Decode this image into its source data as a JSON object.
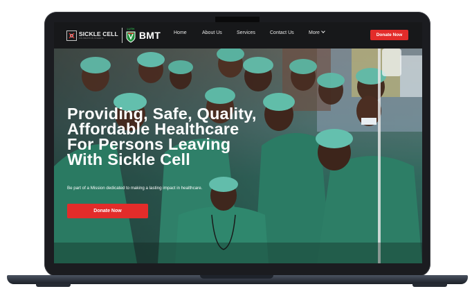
{
  "nav": {
    "logo_text": "SICKLE CELL",
    "logo_subtext": "FOUNDATION NIGERIA",
    "luth_label": "LUTH",
    "brand": "BMT",
    "links": [
      "Home",
      "About Us",
      "Services",
      "Contact Us",
      "More"
    ],
    "donate_label": "Donate Now"
  },
  "hero": {
    "heading_lines": [
      "Providing, Safe, Quality,",
      "Affordable Healthcare",
      "For Persons Leaving",
      "With Sickle Cell"
    ],
    "subtitle": "Be part of a Mission dedicated to making a lasting impact in healthcare.",
    "button_label": "Donate Now"
  },
  "colors": {
    "accent": "#e32c2a",
    "nav_bg": "#17181a",
    "scrub_green": "#2b7a64",
    "luth_green": "#2bb14a"
  }
}
